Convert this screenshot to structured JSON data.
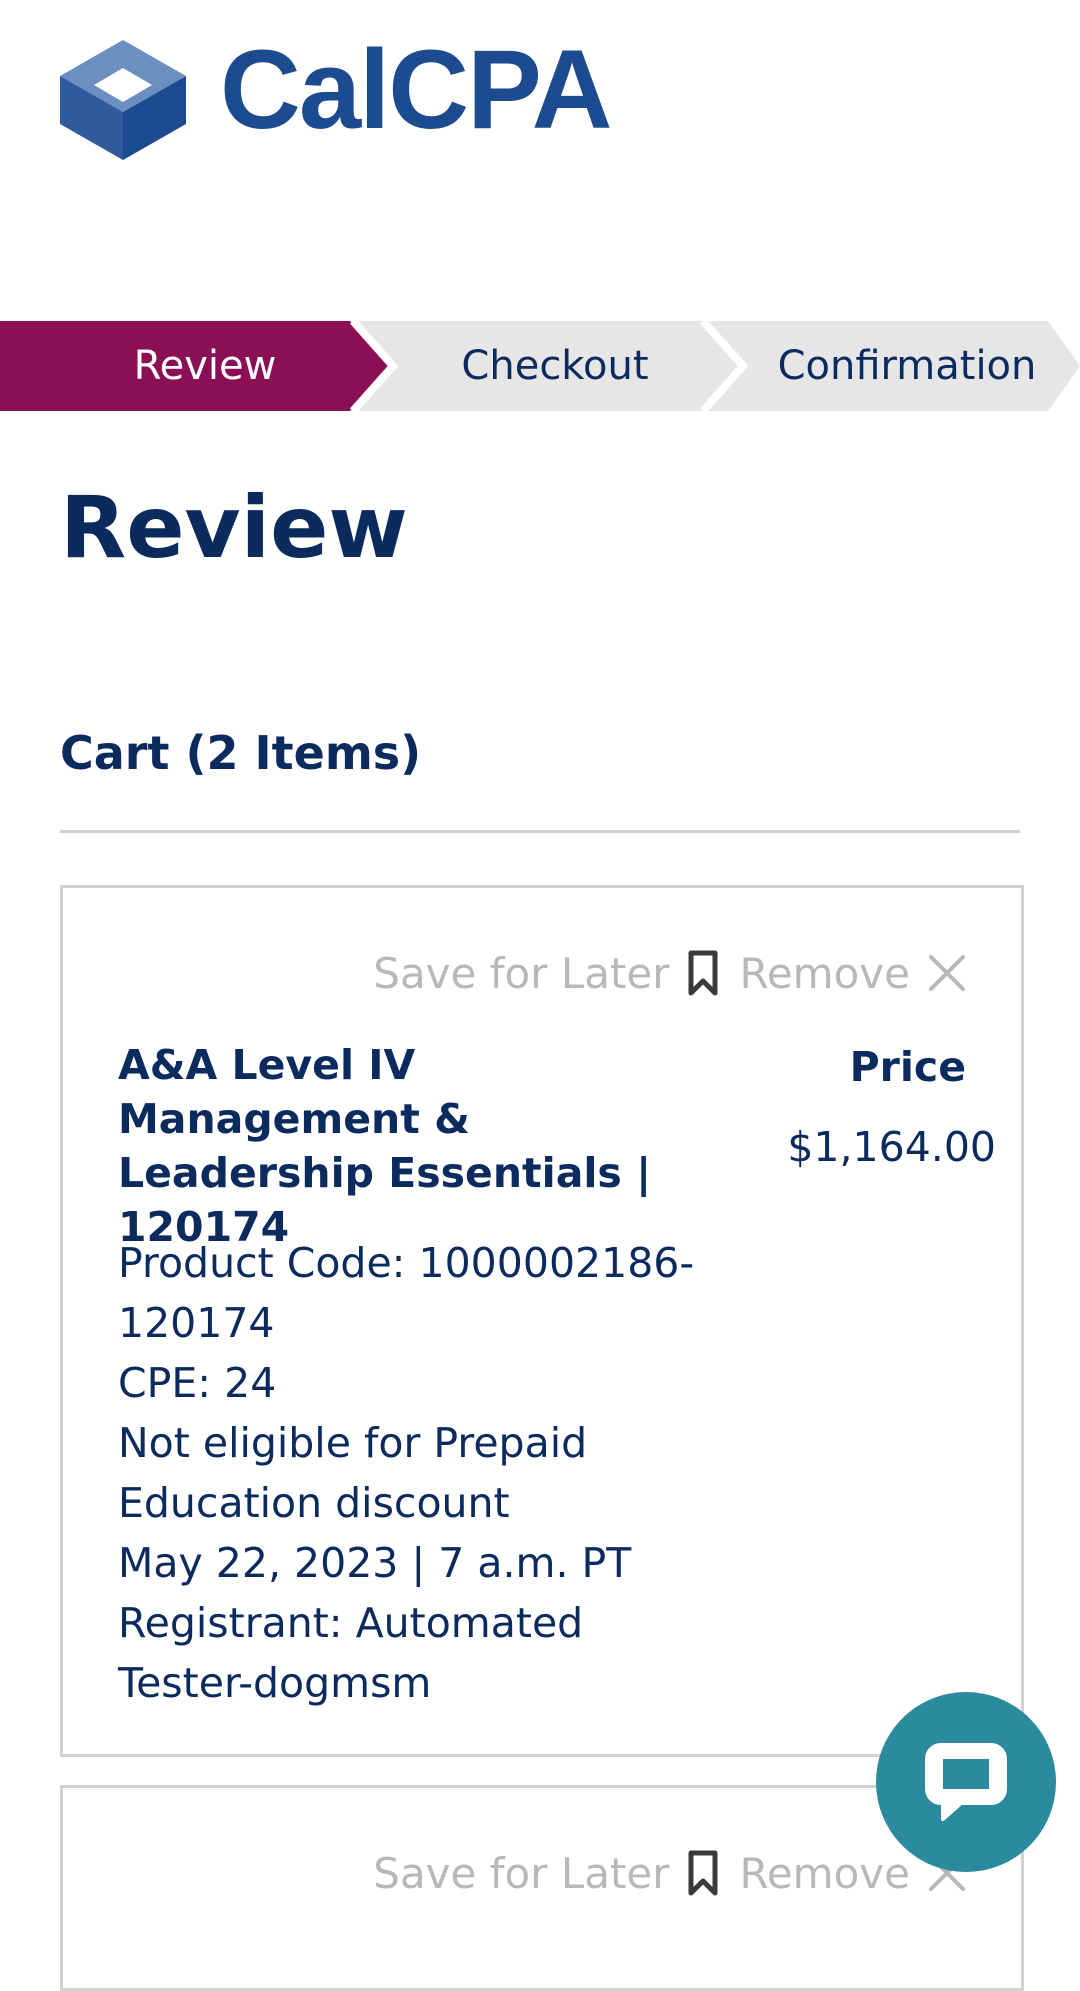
{
  "brand": {
    "name": "CalCPA",
    "colors": {
      "navy": "#0b2a5e",
      "logo_blue": "#1d4b8f",
      "active_step": "#8a0f55",
      "inactive_step": "#e6e6e6",
      "chat": "#2b8a9e"
    }
  },
  "steps": [
    {
      "label": "Review",
      "active": true
    },
    {
      "label": "Checkout",
      "active": false
    },
    {
      "label": "Confirmation",
      "active": false
    }
  ],
  "page_title": "Review",
  "cart": {
    "heading": "Cart (2 Items)",
    "items": [
      {
        "save_label": "Save for Later",
        "save_icon": "bookmark-icon",
        "remove_label": "Remove",
        "remove_icon": "close-icon",
        "title": "A&A Level IV Management & Leadership Essentials | 120174",
        "price_label": "Price",
        "price": "$1,164.00",
        "product_code": "Product Code: 1000002186-120174",
        "cpe": "CPE: 24",
        "eligibility": "Not eligible for Prepaid Education discount",
        "datetime": "May 22, 2023 | 7 a.m. PT",
        "registrant": "Registrant: Automated Tester-dogmsm"
      },
      {
        "save_label": "Save for Later",
        "save_icon": "bookmark-icon",
        "remove_label": "Remove",
        "remove_icon": "close-icon"
      }
    ]
  },
  "chat": {
    "icon": "chat-bubble-icon"
  }
}
